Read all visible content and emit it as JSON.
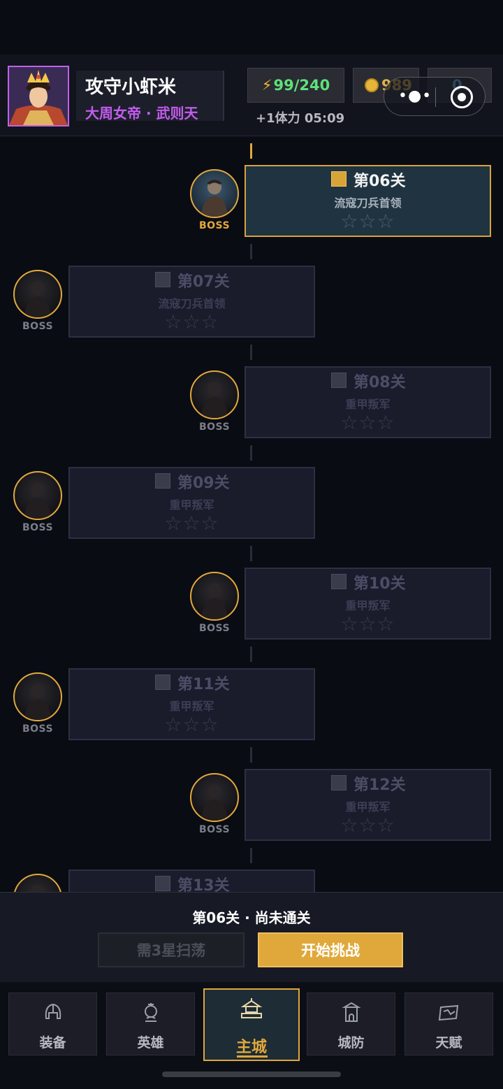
{
  "header": {
    "player_name": "攻守小虾米",
    "player_title": "大周女帝 · 武则天",
    "stamina": "99/240",
    "gold": "989",
    "gems": "0",
    "stamina_regen": "+1体力 05:09",
    "avatar_icon": "empress-portrait",
    "stamina_icon": "lightning-bolt-icon",
    "gold_icon": "gold-coin-icon",
    "gem_icon": "diamond-icon"
  },
  "mini_program_capsule": {
    "more": "•●•",
    "close_icon": "target-icon"
  },
  "stages": [
    {
      "label": "第06关",
      "enemy": "流寇刀兵首领",
      "stars": "☆☆☆",
      "boss": "BOSS",
      "active": true
    },
    {
      "label": "第07关",
      "enemy": "流寇刀兵首领",
      "stars": "☆☆☆",
      "boss": "BOSS",
      "active": false
    },
    {
      "label": "第08关",
      "enemy": "重甲叛军",
      "stars": "☆☆☆",
      "boss": "BOSS",
      "active": false
    },
    {
      "label": "第09关",
      "enemy": "重甲叛军",
      "stars": "☆☆☆",
      "boss": "BOSS",
      "active": false
    },
    {
      "label": "第10关",
      "enemy": "重甲叛军",
      "stars": "☆☆☆",
      "boss": "BOSS",
      "active": false
    },
    {
      "label": "第11关",
      "enemy": "重甲叛军",
      "stars": "☆☆☆",
      "boss": "BOSS",
      "active": false
    },
    {
      "label": "第12关",
      "enemy": "重甲叛军",
      "stars": "☆☆☆",
      "boss": "BOSS",
      "active": false
    },
    {
      "label": "第13关",
      "enemy": "",
      "stars": "",
      "boss": "",
      "active": false
    }
  ],
  "action_panel": {
    "status": "第06关 · 尚未通关",
    "sweep_button": "需3星扫荡",
    "start_button": "开始挑战"
  },
  "nav": {
    "tabs": [
      {
        "label": "装备",
        "icon": "helmet-icon",
        "active": false
      },
      {
        "label": "英雄",
        "icon": "hero-crest-icon",
        "active": false
      },
      {
        "label": "主城",
        "icon": "palace-icon",
        "active": true
      },
      {
        "label": "城防",
        "icon": "gate-tower-icon",
        "active": false
      },
      {
        "label": "天赋",
        "icon": "talent-scroll-icon",
        "active": false
      }
    ]
  },
  "colors": {
    "accent": "#e0a83a",
    "background": "#0a0c14",
    "stamina": "#5ee07a",
    "title_purple": "#c45cf0"
  }
}
